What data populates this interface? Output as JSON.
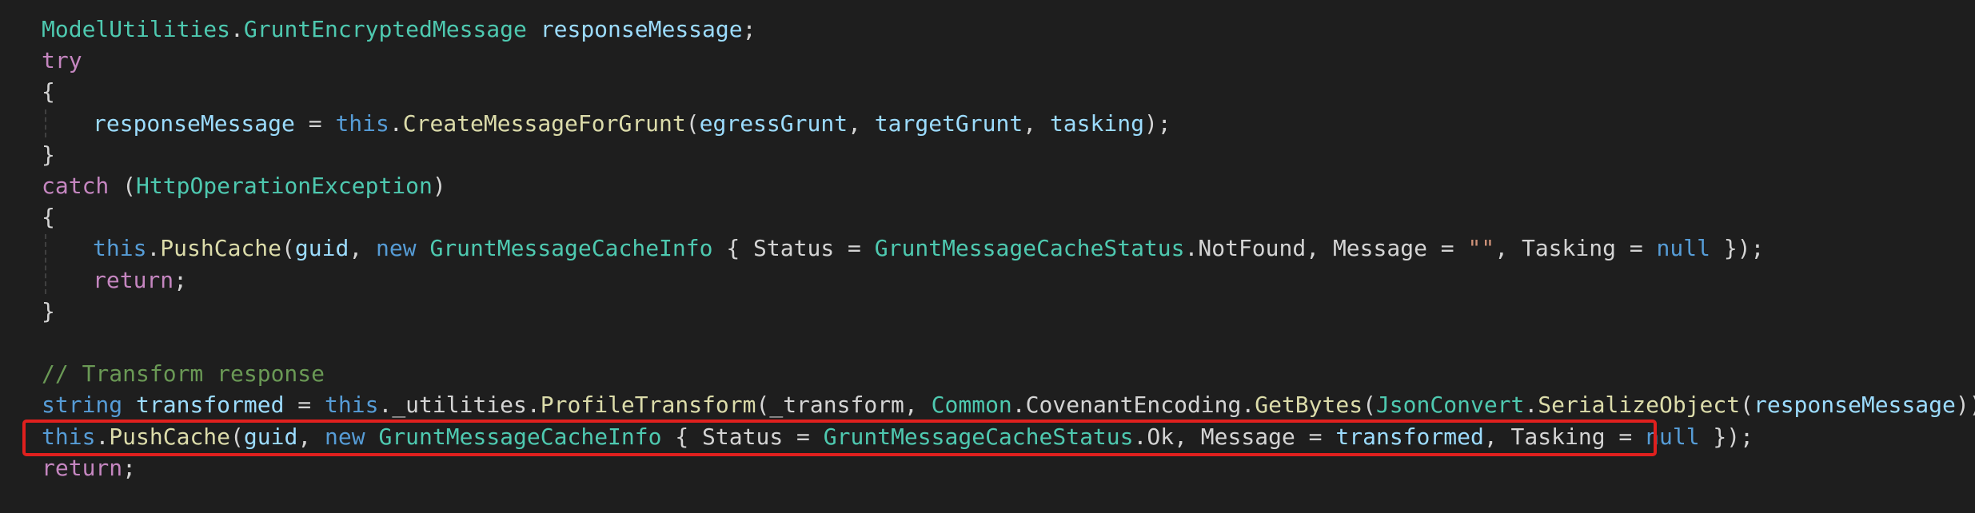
{
  "code": {
    "lines": [
      [
        [
          "type",
          "ModelUtilities"
        ],
        [
          "plain",
          "."
        ],
        [
          "type",
          "GruntEncryptedMessage"
        ],
        [
          "plain",
          " "
        ],
        [
          "var",
          "responseMessage"
        ],
        [
          "plain",
          ";"
        ]
      ],
      [
        [
          "kw-ctrl",
          "try"
        ]
      ],
      [
        [
          "plain",
          "{"
        ]
      ],
      [
        [
          "indent",
          ""
        ],
        [
          "var",
          "responseMessage"
        ],
        [
          "plain",
          " = "
        ],
        [
          "kw",
          "this"
        ],
        [
          "plain",
          "."
        ],
        [
          "method",
          "CreateMessageForGrunt"
        ],
        [
          "plain",
          "("
        ],
        [
          "var",
          "egressGrunt"
        ],
        [
          "plain",
          ", "
        ],
        [
          "var",
          "targetGrunt"
        ],
        [
          "plain",
          ", "
        ],
        [
          "var",
          "tasking"
        ],
        [
          "plain",
          ");"
        ]
      ],
      [
        [
          "plain",
          "}"
        ]
      ],
      [
        [
          "kw-ctrl",
          "catch"
        ],
        [
          "plain",
          " ("
        ],
        [
          "type",
          "HttpOperationException"
        ],
        [
          "plain",
          ")"
        ]
      ],
      [
        [
          "plain",
          "{"
        ]
      ],
      [
        [
          "indent",
          ""
        ],
        [
          "kw",
          "this"
        ],
        [
          "plain",
          "."
        ],
        [
          "method",
          "PushCache"
        ],
        [
          "plain",
          "("
        ],
        [
          "var",
          "guid"
        ],
        [
          "plain",
          ", "
        ],
        [
          "kw",
          "new"
        ],
        [
          "plain",
          " "
        ],
        [
          "type",
          "GruntMessageCacheInfo"
        ],
        [
          "plain",
          " { Status = "
        ],
        [
          "type",
          "GruntMessageCacheStatus"
        ],
        [
          "plain",
          ".NotFound, Message = "
        ],
        [
          "str",
          "\"\""
        ],
        [
          "plain",
          ", Tasking = "
        ],
        [
          "kw",
          "null"
        ],
        [
          "plain",
          " });"
        ]
      ],
      [
        [
          "indent",
          ""
        ],
        [
          "kw-ctrl",
          "return"
        ],
        [
          "plain",
          ";"
        ]
      ],
      [
        [
          "plain",
          "}"
        ]
      ],
      [],
      [
        [
          "comment",
          "// Transform response"
        ]
      ],
      [
        [
          "kw",
          "string"
        ],
        [
          "plain",
          " "
        ],
        [
          "var",
          "transformed"
        ],
        [
          "plain",
          " = "
        ],
        [
          "kw",
          "this"
        ],
        [
          "plain",
          "._utilities."
        ],
        [
          "method",
          "ProfileTransform"
        ],
        [
          "plain",
          "(_transform, "
        ],
        [
          "type",
          "Common"
        ],
        [
          "plain",
          ".CovenantEncoding."
        ],
        [
          "method",
          "GetBytes"
        ],
        [
          "plain",
          "("
        ],
        [
          "type",
          "JsonConvert"
        ],
        [
          "plain",
          "."
        ],
        [
          "method",
          "SerializeObject"
        ],
        [
          "plain",
          "("
        ],
        [
          "var",
          "responseMessage"
        ],
        [
          "plain",
          ")));"
        ]
      ],
      [
        [
          "kw",
          "this"
        ],
        [
          "plain",
          "."
        ],
        [
          "method",
          "PushCache"
        ],
        [
          "plain",
          "("
        ],
        [
          "var",
          "guid"
        ],
        [
          "plain",
          ", "
        ],
        [
          "kw",
          "new"
        ],
        [
          "plain",
          " "
        ],
        [
          "type",
          "GruntMessageCacheInfo"
        ],
        [
          "plain",
          " { Status = "
        ],
        [
          "type",
          "GruntMessageCacheStatus"
        ],
        [
          "plain",
          ".Ok, Message = "
        ],
        [
          "var",
          "transformed"
        ],
        [
          "plain",
          ", Tasking = "
        ],
        [
          "kw",
          "null"
        ],
        [
          "plain",
          " });"
        ]
      ],
      [
        [
          "kw-ctrl",
          "return"
        ],
        [
          "plain",
          ";"
        ]
      ]
    ],
    "highlighted_line": 13,
    "colors": {
      "background": "#1e1e1e",
      "highlight_border": "#e0201e"
    }
  }
}
